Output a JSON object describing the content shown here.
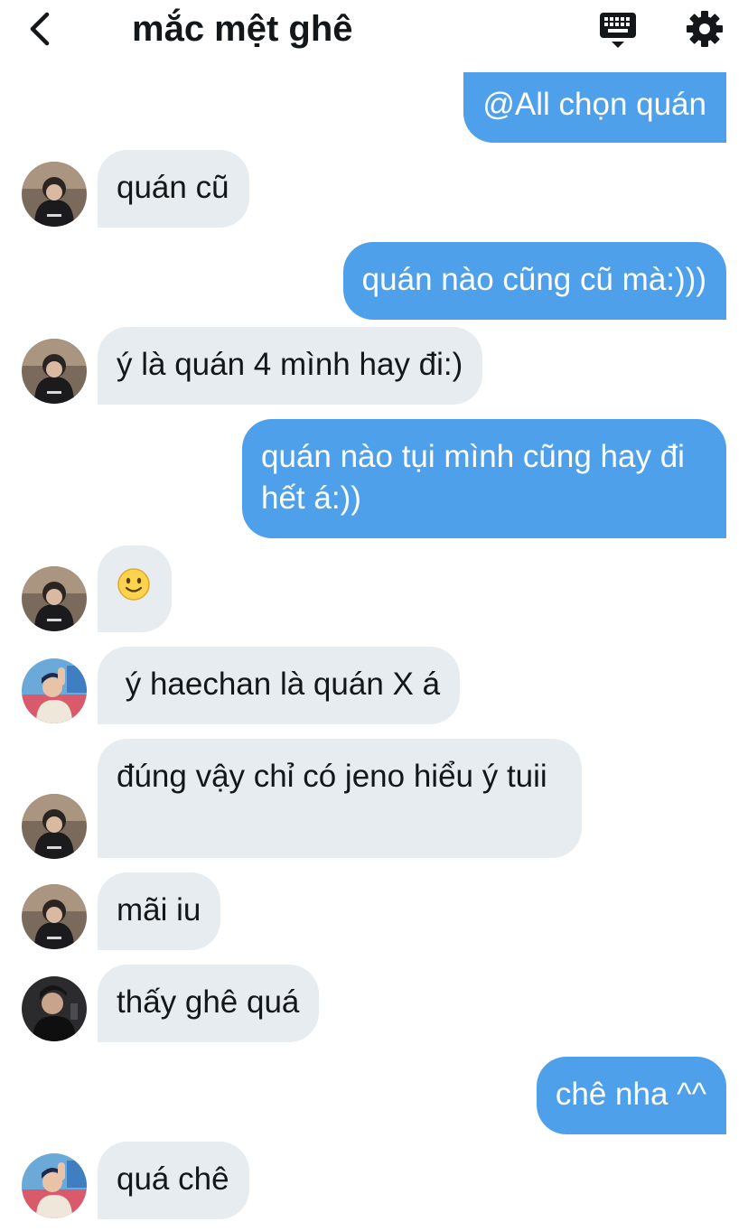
{
  "header": {
    "title": "mắc mệt ghê"
  },
  "colors": {
    "outgoing_bubble": "#4ea0ea",
    "incoming_bubble": "#e6ecf0",
    "text": "#14171a"
  },
  "icons": {
    "back": "chevron-left-icon",
    "keyboard": "keyboard-icon",
    "settings": "gear-icon"
  },
  "messages": [
    {
      "direction": "out",
      "text": "@All chọn quán"
    },
    {
      "direction": "in",
      "avatar": "avatar-a",
      "text": "quán cũ"
    },
    {
      "direction": "out",
      "text": "quán nào cũng cũ mà:)))"
    },
    {
      "direction": "in",
      "avatar": "avatar-a",
      "text": "ý là quán 4 mình hay đi:)"
    },
    {
      "direction": "out",
      "text": "quán nào tụi mình cũng hay đi hết á:))"
    },
    {
      "direction": "in",
      "avatar": "avatar-a",
      "text": "🙂"
    },
    {
      "direction": "in",
      "avatar": "avatar-b",
      "text": " ý haechan là quán X á"
    },
    {
      "direction": "in",
      "avatar": "avatar-a",
      "text": "đúng vậy chỉ có jeno hiểu ý tuii"
    },
    {
      "direction": "in",
      "avatar": "avatar-a",
      "text": "mãi iu"
    },
    {
      "direction": "in",
      "avatar": "avatar-c",
      "text": "thấy ghê quá"
    },
    {
      "direction": "out",
      "text": "chê nha ^^"
    },
    {
      "direction": "in",
      "avatar": "avatar-b",
      "text": "quá chê"
    }
  ]
}
